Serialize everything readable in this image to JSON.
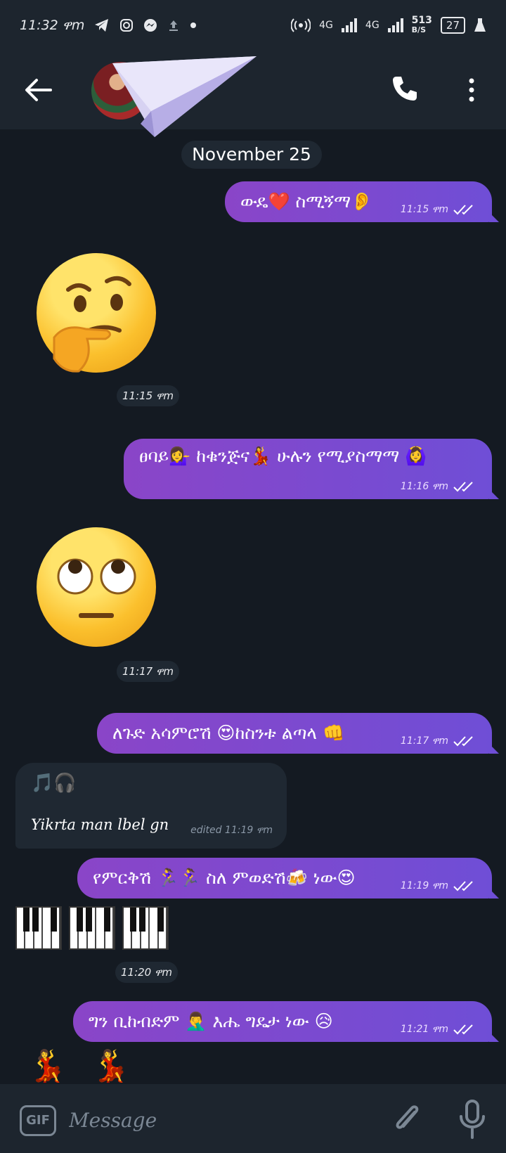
{
  "status_bar": {
    "time": "11:32 ዋm",
    "network_1": "4G",
    "network_2": "4G",
    "speed": "513",
    "speed_unit": "B/S",
    "battery": "27"
  },
  "chat": {
    "date": "November 25",
    "messages": [
      {
        "text": "ውዴ❤️ ስሚኝማ👂",
        "time": "11:15 ዋm"
      },
      {
        "emoji": "🤔",
        "time": "11:15 ዋm"
      },
      {
        "text": "ፀባይ💁‍♀️ ከቁንጅና💃 ሁሉን የሚያስማማ 🙆‍♀️",
        "time": "11:16 ዋm"
      },
      {
        "emoji": "🙄",
        "time": "11:17 ዋm"
      },
      {
        "text": "ለጉድ አሳምሮሽ 😍ከስንቱ ልጣላ 👊",
        "time": "11:17 ዋm"
      },
      {
        "notes": "🎵🎧",
        "caption": "Yikrta man lbel gn",
        "edited": "edited 11:19 ዋm"
      },
      {
        "text": "የምርቅሽ 🏃‍♀️🏃‍♀️ ስለ ምወድሽ🍻 ነው😍",
        "time": "11:19 ዋm"
      },
      {
        "time": "11:20 ዋm"
      },
      {
        "text": "ግን ቢከብድም 🤦‍♂️ እሔ ግዴታ ነው 😥",
        "time": "11:21 ዋm"
      }
    ],
    "dancers": [
      "💃",
      "💃"
    ]
  },
  "composer": {
    "gif_label": "GIF",
    "placeholder": "Message"
  },
  "colors": {
    "background": "#141a22",
    "bar": "#1d252e",
    "bubble_out_start": "#8a45c8",
    "bubble_out_end": "#6f4ed6",
    "bubble_in": "#1f2832"
  }
}
